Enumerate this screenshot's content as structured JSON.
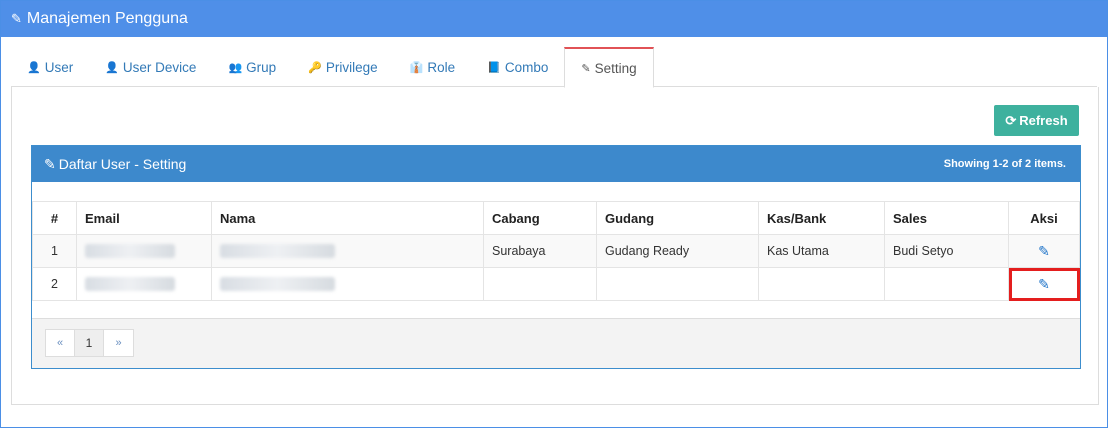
{
  "header": {
    "title": "Manajemen Pengguna",
    "icon": "pencil-icon"
  },
  "tabs": [
    {
      "label": "User",
      "icon": "user-icon",
      "active": false
    },
    {
      "label": "User Device",
      "icon": "user-icon",
      "active": false
    },
    {
      "label": "Grup",
      "icon": "users-icon",
      "active": false
    },
    {
      "label": "Privilege",
      "icon": "key-icon",
      "active": false
    },
    {
      "label": "Role",
      "icon": "user-tie-icon",
      "active": false
    },
    {
      "label": "Combo",
      "icon": "book-icon",
      "active": false
    },
    {
      "label": "Setting",
      "icon": "edit-icon",
      "active": true
    }
  ],
  "toolbar": {
    "refresh_label": "Refresh"
  },
  "panel": {
    "title": "Daftar User - Setting",
    "summary": "Showing 1-2 of 2 items."
  },
  "table": {
    "columns": [
      "#",
      "Email",
      "Nama",
      "Cabang",
      "Gudang",
      "Kas/Bank",
      "Sales",
      "Aksi"
    ],
    "rows": [
      {
        "no": "1",
        "cabang": "Surabaya",
        "gudang": "Gudang Ready",
        "kas_bank": "Kas Utama",
        "sales": "Budi Setyo",
        "highlight": false
      },
      {
        "no": "2",
        "cabang": "",
        "gudang": "",
        "kas_bank": "",
        "sales": "",
        "highlight": true
      }
    ]
  },
  "pagination": {
    "prev": "«",
    "current": "1",
    "next": "»"
  },
  "colors": {
    "header_bg": "#4f8fe8",
    "panel_bg": "#3d89cc",
    "refresh_bg": "#3eb19e",
    "active_tab_border": "#e15256",
    "highlight": "#e41e1e"
  }
}
